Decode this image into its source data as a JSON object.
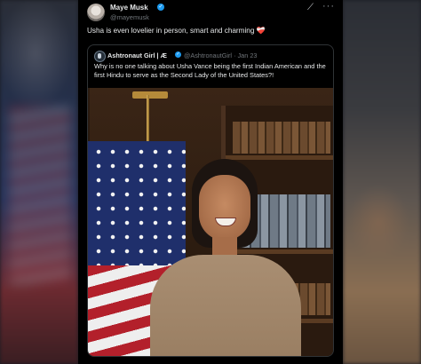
{
  "post": {
    "author_name": "Maye Musk",
    "author_handle": "@mayemusk",
    "text": "Usha is even lovelier in person, smart and charming",
    "text_emoji": "❤️‍🩹",
    "icons": {
      "grok": "grok-icon",
      "more": "more-icon",
      "verified": "verified-badge-icon"
    }
  },
  "quote": {
    "author_name": "Ashtronaut Girl | Æ",
    "author_handle": "@AshtronautGirl · Jan 23",
    "text": "Why is no one talking about Usha Vance being the first Indian American and the first Hindu to serve as the Second Lady of the United States?!"
  },
  "colors": {
    "background": "#000000",
    "text": "#e7e9ea",
    "muted": "#71767b",
    "verified": "#1d9bf0"
  }
}
